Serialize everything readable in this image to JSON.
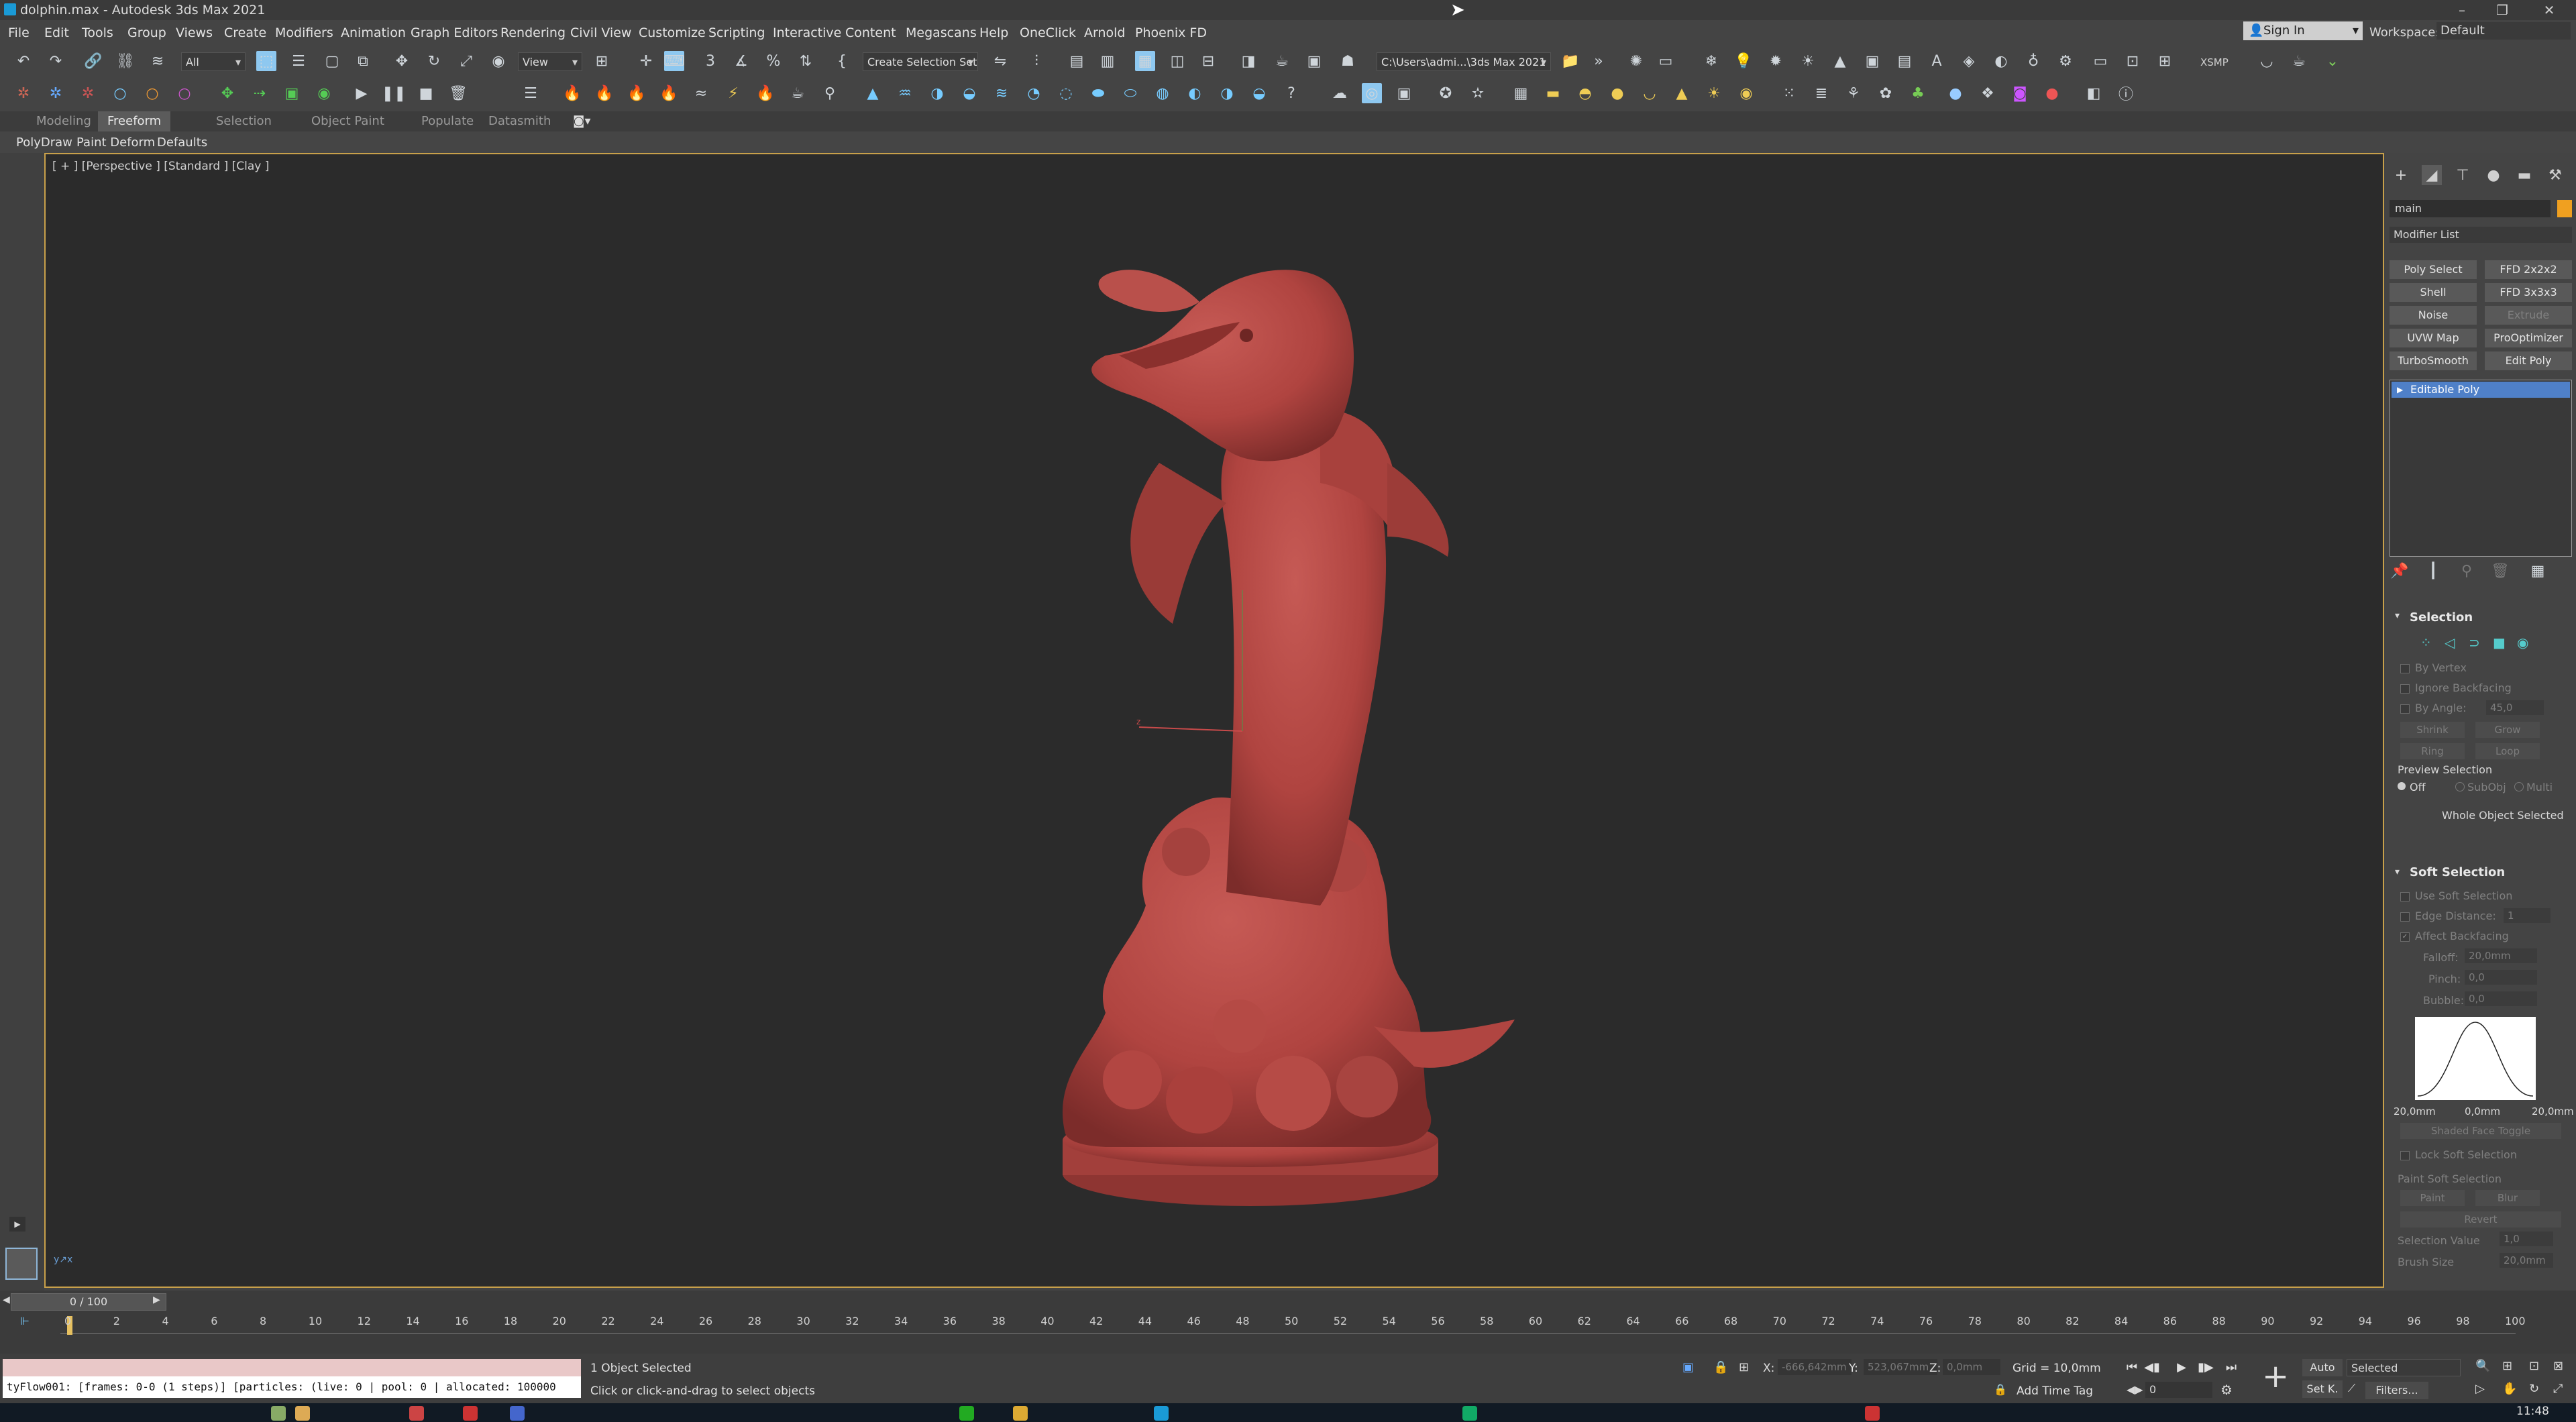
{
  "window": {
    "title": "dolphin.max - Autodesk 3ds Max 2021",
    "controls": [
      "–",
      "❐",
      "✕"
    ]
  },
  "menu": {
    "items": [
      "File",
      "Edit",
      "Tools",
      "Group",
      "Views",
      "Create",
      "Modifiers",
      "Animation",
      "Graph Editors",
      "Rendering",
      "Civil View",
      "Customize",
      "Scripting",
      "Interactive",
      "Content",
      "Megascans",
      "Help",
      "OneClick",
      "Arnold",
      "Phoenix FD"
    ],
    "sign_in": "Sign In",
    "workspaces_label": "Workspaces:",
    "workspace_value": "Default"
  },
  "toolbar": {
    "selection_filter": "All",
    "ref_coord": "View",
    "selection_set": "Create Selection Set",
    "project_path": "C:\\Users\\admi...\\3ds Max 2021",
    "xsmp": "XSMP"
  },
  "ribbon": {
    "tabs": [
      "Modeling",
      "Freeform",
      "Selection",
      "Object Paint",
      "Populate",
      "Datasmith"
    ],
    "active_tab": "Freeform",
    "subtabs": [
      "PolyDraw",
      "Paint Deform",
      "Defaults"
    ]
  },
  "viewport": {
    "label": "[ + ] [Perspective ] [Standard ] [Clay ]",
    "model_name": "dolphin",
    "model_color": "#b84a46",
    "border_color": "#c8a04a"
  },
  "command_panel": {
    "object_name": "main",
    "object_color": "#f0a020",
    "modifier_list": "Modifier List",
    "modifier_buttons": [
      {
        "label": "Poly Select",
        "enabled": true
      },
      {
        "label": "FFD 2x2x2",
        "enabled": true
      },
      {
        "label": "Shell",
        "enabled": true
      },
      {
        "label": "FFD 3x3x3",
        "enabled": true
      },
      {
        "label": "Noise",
        "enabled": true
      },
      {
        "label": "Extrude",
        "enabled": false
      },
      {
        "label": "UVW Map",
        "enabled": true
      },
      {
        "label": "ProOptimizer",
        "enabled": true
      },
      {
        "label": "TurboSmooth",
        "enabled": true
      },
      {
        "label": "Edit Poly",
        "enabled": true
      }
    ],
    "stack_item": "Editable Poly",
    "selection": {
      "title": "Selection",
      "by_vertex": "By Vertex",
      "ignore_backfacing": "Ignore Backfacing",
      "by_angle": "By Angle:",
      "by_angle_value": "45,0",
      "shrink": "Shrink",
      "grow": "Grow",
      "ring": "Ring",
      "loop": "Loop",
      "preview_selection": "Preview Selection",
      "preview_off": "Off",
      "preview_subobj": "SubObj",
      "preview_multi": "Multi",
      "status": "Whole Object Selected"
    },
    "soft_selection": {
      "title": "Soft Selection",
      "use_soft": "Use Soft Selection",
      "edge_distance": "Edge Distance:",
      "edge_distance_value": "1",
      "affect_backfacing": "Affect Backfacing",
      "falloff": "Falloff:",
      "falloff_value": "20,0mm",
      "pinch": "Pinch:",
      "pinch_value": "0,0",
      "bubble": "Bubble:",
      "bubble_value": "0,0",
      "curve_left": "20,0mm",
      "curve_mid": "0,0mm",
      "curve_right": "20,0mm",
      "shaded_face_toggle": "Shaded Face Toggle",
      "lock_soft": "Lock Soft Selection",
      "paint_soft": "Paint Soft Selection",
      "paint": "Paint",
      "blur": "Blur",
      "revert": "Revert",
      "selection_value": "Selection Value",
      "selection_value_num": "1,0",
      "brush_size": "Brush Size",
      "brush_size_num": "20,0mm"
    }
  },
  "timeline": {
    "slider_label": "0 / 100",
    "ticks": [
      "0",
      "2",
      "4",
      "6",
      "8",
      "10",
      "12",
      "14",
      "16",
      "18",
      "20",
      "22",
      "24",
      "26",
      "28",
      "30",
      "32",
      "34",
      "36",
      "38",
      "40",
      "42",
      "44",
      "46",
      "48",
      "50",
      "52",
      "54",
      "56",
      "58",
      "60",
      "62",
      "64",
      "66",
      "68",
      "70",
      "72",
      "74",
      "76",
      "78",
      "80",
      "82",
      "84",
      "86",
      "88",
      "90",
      "92",
      "94",
      "96",
      "98",
      "100"
    ]
  },
  "status": {
    "maxscript_output": "tyFlow001: [frames: 0-0 (1 steps)] [particles: (live: 0 | pool: 0 | allocated: 100000",
    "objects_selected": "1 Object Selected",
    "prompt": "Click or click-and-drag to select objects",
    "x_label": "X:",
    "x_value": "-666,642mm",
    "y_label": "Y:",
    "y_value": "523,067mm",
    "z_label": "Z:",
    "z_value": "0,0mm",
    "grid": "Grid = 10,0mm",
    "add_time_tag": "Add Time Tag",
    "auto_key": "Auto",
    "set_key": "Set K.",
    "key_filter": "Selected",
    "filters": "Filters...",
    "current_frame": "0"
  },
  "taskbar": {
    "clock": "11:48"
  }
}
